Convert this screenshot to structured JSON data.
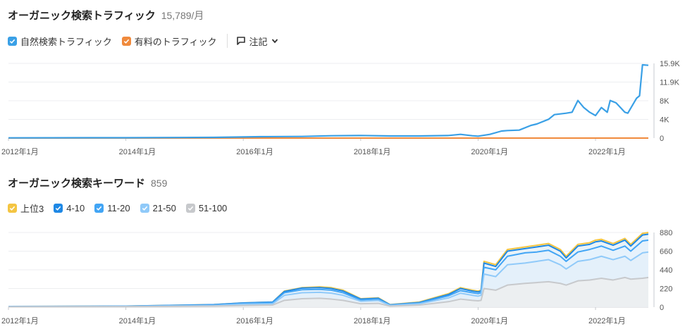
{
  "traffic": {
    "title": "オーガニック検索トラフィック",
    "value": "15,789/月",
    "legend": [
      {
        "label": "自然検索トラフィック",
        "color": "#3aa0e6"
      },
      {
        "label": "有料のトラフィック",
        "color": "#f08a3c"
      }
    ],
    "notes_label": "注記"
  },
  "keywords": {
    "title": "オーガニック検索キーワード",
    "value": "859",
    "legend": [
      {
        "label": "上位3",
        "color": "#f4c542"
      },
      {
        "label": "4-10",
        "color": "#1e88e5"
      },
      {
        "label": "11-20",
        "color": "#42a5f5"
      },
      {
        "label": "21-50",
        "color": "#90caf9"
      },
      {
        "label": "51-100",
        "color": "#c7c9cc"
      }
    ]
  },
  "chart_data": [
    {
      "type": "line",
      "title": "オーガニック検索トラフィック",
      "x_ticks": [
        "2012年1月",
        "2014年1月",
        "2016年1月",
        "2018年1月",
        "2020年1月",
        "2022年1月"
      ],
      "y_ticks": [
        "0",
        "4K",
        "8K",
        "11.9K",
        "15.9K"
      ],
      "ylim": [
        0,
        15900
      ],
      "xlim": [
        2012.0,
        2022.9
      ],
      "series": [
        {
          "name": "自然検索トラフィック",
          "color": "#3aa0e6",
          "x": [
            2012.0,
            2014.0,
            2015.5,
            2016.3,
            2017.0,
            2017.5,
            2018.0,
            2018.5,
            2019.0,
            2019.5,
            2019.7,
            2019.9,
            2020.0,
            2020.2,
            2020.4,
            2020.5,
            2020.7,
            2020.9,
            2021.0,
            2021.2,
            2021.3,
            2021.5,
            2021.6,
            2021.7,
            2021.8,
            2021.9,
            2022.0,
            2022.1,
            2022.2,
            2022.25,
            2022.35,
            2022.5,
            2022.55,
            2022.7,
            2022.75,
            2022.8,
            2022.9
          ],
          "y": [
            50,
            80,
            150,
            300,
            350,
            500,
            550,
            450,
            450,
            550,
            800,
            500,
            400,
            800,
            1500,
            1600,
            1700,
            2700,
            3000,
            4000,
            5000,
            5300,
            5500,
            8000,
            6500,
            5500,
            4800,
            6500,
            5500,
            8000,
            7500,
            5500,
            5300,
            8500,
            9000,
            15600,
            15500
          ]
        },
        {
          "name": "有料のトラフィック",
          "color": "#f08a3c",
          "x": [
            2012.0,
            2022.9
          ],
          "y": [
            0,
            0
          ]
        }
      ]
    },
    {
      "type": "area",
      "title": "オーガニック検索キーワード",
      "x_ticks": [
        "2012年1月",
        "2014年1月",
        "2016年1月",
        "2018年1月",
        "2020年1月",
        "2022年1月"
      ],
      "y_ticks": [
        "0",
        "220",
        "440",
        "660",
        "880"
      ],
      "ylim": [
        0,
        880
      ],
      "xlim": [
        2012.0,
        2022.9
      ],
      "x": [
        2012.0,
        2014.0,
        2015.5,
        2016.0,
        2016.5,
        2016.7,
        2017.0,
        2017.3,
        2017.5,
        2017.7,
        2018.0,
        2018.3,
        2018.5,
        2019.0,
        2019.5,
        2019.7,
        2019.9,
        2020.0,
        2020.05,
        2020.1,
        2020.3,
        2020.5,
        2020.8,
        2021.0,
        2021.2,
        2021.4,
        2021.5,
        2021.7,
        2021.9,
        2022.0,
        2022.1,
        2022.3,
        2022.5,
        2022.6,
        2022.8,
        2022.9
      ],
      "series": [
        {
          "name": "上位3",
          "color": "#f4c542",
          "values": [
            8,
            12,
            30,
            50,
            60,
            190,
            230,
            240,
            230,
            200,
            100,
            110,
            30,
            60,
            160,
            230,
            200,
            190,
            200,
            540,
            500,
            680,
            710,
            730,
            750,
            680,
            600,
            740,
            760,
            790,
            800,
            750,
            810,
            740,
            870,
            880
          ]
        },
        {
          "name": "4-10",
          "color": "#1e88e5",
          "values": [
            8,
            12,
            30,
            50,
            60,
            185,
            225,
            230,
            220,
            190,
            95,
            105,
            28,
            55,
            150,
            220,
            190,
            180,
            190,
            520,
            480,
            660,
            690,
            710,
            730,
            660,
            580,
            720,
            740,
            770,
            780,
            730,
            790,
            720,
            850,
            860
          ]
        },
        {
          "name": "11-20",
          "color": "#42a5f5",
          "values": [
            7,
            11,
            25,
            45,
            55,
            170,
            205,
            210,
            200,
            170,
            85,
            95,
            25,
            50,
            135,
            195,
            170,
            160,
            170,
            470,
            440,
            600,
            640,
            650,
            670,
            600,
            540,
            650,
            680,
            700,
            720,
            670,
            720,
            660,
            780,
            790
          ]
        },
        {
          "name": "21-50",
          "color": "#90caf9",
          "values": [
            6,
            9,
            20,
            35,
            40,
            140,
            170,
            175,
            165,
            140,
            70,
            80,
            20,
            40,
            110,
            165,
            140,
            130,
            140,
            390,
            360,
            500,
            520,
            540,
            560,
            500,
            450,
            540,
            560,
            580,
            600,
            560,
            600,
            550,
            640,
            650
          ]
        },
        {
          "name": "51-100",
          "color": "#c7c9cc",
          "values": [
            4,
            6,
            12,
            20,
            25,
            80,
            100,
            105,
            95,
            80,
            40,
            45,
            12,
            25,
            65,
            95,
            80,
            75,
            80,
            220,
            200,
            260,
            280,
            290,
            300,
            280,
            260,
            310,
            320,
            330,
            340,
            320,
            350,
            330,
            340,
            350
          ]
        }
      ]
    }
  ]
}
